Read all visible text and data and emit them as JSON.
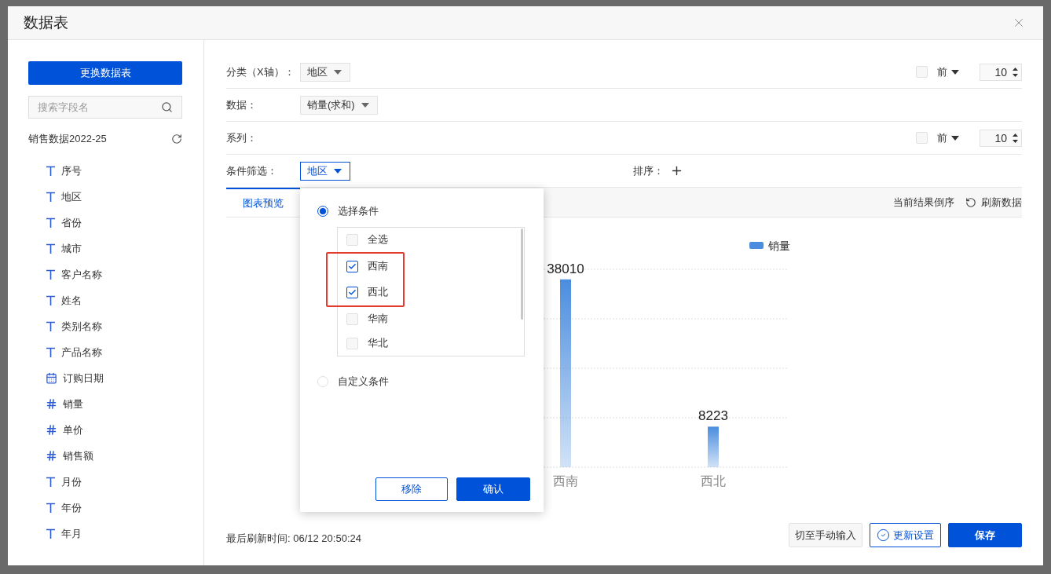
{
  "window": {
    "title": "数据表"
  },
  "sidebar": {
    "change_button": "更换数据表",
    "search": {
      "placeholder": "搜索字段名"
    },
    "dataset": "销售数据2022-25",
    "fields": [
      {
        "label": "序号",
        "kind": "text"
      },
      {
        "label": "地区",
        "kind": "text"
      },
      {
        "label": "省份",
        "kind": "text"
      },
      {
        "label": "城市",
        "kind": "text"
      },
      {
        "label": "客户名称",
        "kind": "text"
      },
      {
        "label": "姓名",
        "kind": "text"
      },
      {
        "label": "类别名称",
        "kind": "text"
      },
      {
        "label": "产品名称",
        "kind": "text"
      },
      {
        "label": "订购日期",
        "kind": "date"
      },
      {
        "label": "销量",
        "kind": "number"
      },
      {
        "label": "单价",
        "kind": "number"
      },
      {
        "label": "销售额",
        "kind": "number"
      },
      {
        "label": "月份",
        "kind": "text"
      },
      {
        "label": "年份",
        "kind": "text"
      },
      {
        "label": "年月",
        "kind": "text"
      }
    ]
  },
  "settings": [
    {
      "label": "分类（X轴）：",
      "dropdown": {
        "value": "地区",
        "open": false
      },
      "top_n": {
        "checked": false,
        "mode": "前",
        "value": "10"
      }
    },
    {
      "label": "数据：",
      "dropdown": {
        "value": "销量(求和)",
        "open": false
      }
    },
    {
      "label": "系列：",
      "top_n": {
        "checked": false,
        "mode": "前",
        "value": "10"
      }
    },
    {
      "label": "条件筛选：",
      "dropdown": {
        "value": "地区",
        "open": true
      },
      "sort_label": "排序："
    }
  ],
  "filter_popup": {
    "modes": [
      {
        "label": "选择条件",
        "selected": true
      },
      {
        "label": "自定义条件",
        "selected": false
      }
    ],
    "options": [
      {
        "label": "全选",
        "checked": false,
        "highlighted": false
      },
      {
        "label": "西南",
        "checked": true,
        "highlighted": true
      },
      {
        "label": "西北",
        "checked": true,
        "highlighted": true
      },
      {
        "label": "华南",
        "checked": false,
        "highlighted": false
      },
      {
        "label": "华北",
        "checked": false,
        "highlighted": false
      }
    ],
    "buttons": [
      {
        "label": "移除",
        "kind": "secondary"
      },
      {
        "label": "确认",
        "kind": "primary"
      }
    ]
  },
  "tabs": [
    {
      "label": "图表预览",
      "selected": true
    }
  ],
  "toolbar": {
    "reverse": "当前结果倒序",
    "refresh": "刷新数据"
  },
  "chart_data": {
    "type": "bar",
    "categories": [
      "西南",
      "西北"
    ],
    "series": [
      {
        "name": "销量",
        "color": "#4a8ddf",
        "values": [
          38010,
          8223
        ]
      }
    ],
    "data_labels": true
  },
  "footer": {
    "last_refresh": "最后刷新时间: 06/12 20:50:24",
    "buttons": [
      {
        "label": "切至手动输入",
        "kind": "plain"
      },
      {
        "label": "更新设置",
        "kind": "outline"
      },
      {
        "label": "保存",
        "kind": "primary"
      }
    ]
  }
}
